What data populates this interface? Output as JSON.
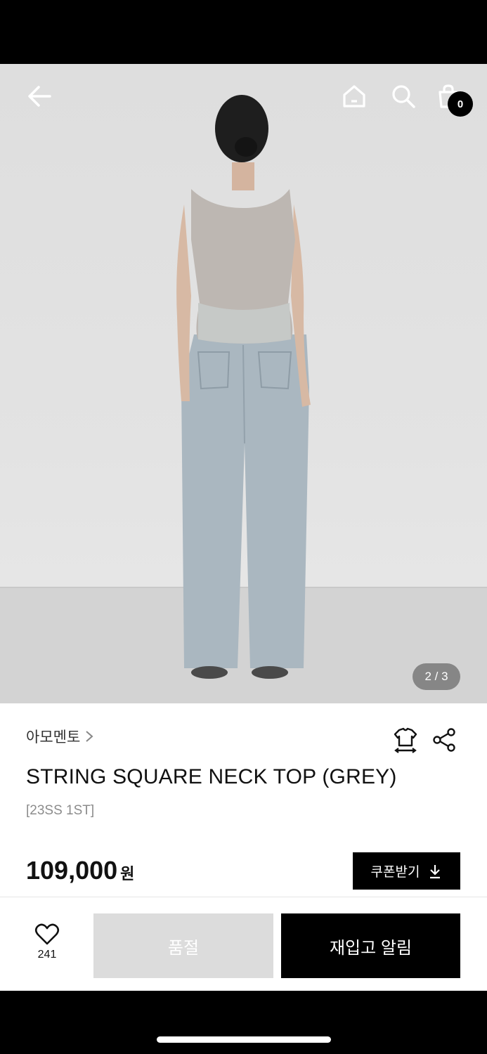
{
  "header": {
    "back_icon": "arrow-left-icon",
    "home_icon": "home-icon",
    "search_icon": "search-icon",
    "cart_icon": "shopping-bag-icon",
    "cart_count": "0"
  },
  "gallery": {
    "counter": "2 / 3",
    "current": 2,
    "total": 3
  },
  "product": {
    "brand": "아모멘토",
    "title": "STRING SQUARE NECK TOP (GREY)",
    "subtitle": "[23SS 1ST]",
    "price": "109,000",
    "price_unit": "원",
    "size_icon": "size-guide-icon",
    "share_icon": "share-icon"
  },
  "coupon": {
    "label": "쿠폰받기",
    "icon": "download-icon"
  },
  "actions": {
    "like_icon": "heart-icon",
    "like_count": "241",
    "soldout_label": "품절",
    "restock_label": "재입고 알림"
  },
  "colors": {
    "primary": "#000000",
    "disabled": "#dcdcdc",
    "muted": "#8c8c8c"
  }
}
